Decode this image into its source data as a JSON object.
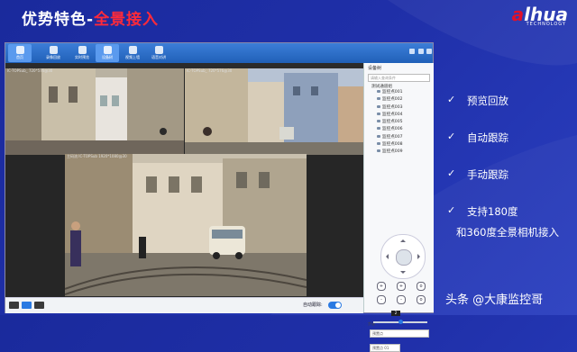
{
  "slide": {
    "title_main": "优势特色-",
    "title_accent": "全景接入",
    "brand_prefix": "a",
    "brand_rest": "lhua",
    "brand_sub": "TECHNOLOGY",
    "watermark": "头条 @大康监控哥"
  },
  "toolbar": {
    "items": [
      {
        "label": "首页",
        "active": true
      },
      {
        "label": "录像回放",
        "active": false
      },
      {
        "label": "实时预览",
        "active": false
      },
      {
        "label": "设备树",
        "active": true
      },
      {
        "label": "视频上墙",
        "active": false
      },
      {
        "label": "语音对讲",
        "active": false
      }
    ]
  },
  "videos": {
    "top_left_label": "IC-TOPSub_  720*576@30",
    "top_right_label": "IC-TOPSub_  720*576@30",
    "main_label": "主码流 IC-TOPSub 1920*1080@30"
  },
  "panel": {
    "header": "设备树",
    "search_placeholder": "请输入查询条件",
    "root": "测试通道组",
    "devices": [
      "监控点001",
      "监控点002",
      "监控点003",
      "监控点004",
      "监控点005",
      "监控点006",
      "监控点007",
      "监控点008",
      "监控点009"
    ],
    "speed_value": "2",
    "speed_label": "步速",
    "preset1": "预置点",
    "preset2": "预置点 01"
  },
  "bottom": {
    "auto_track_label": "自动跟踪:"
  },
  "features": [
    {
      "text": "预览回放"
    },
    {
      "text": "自动跟踪"
    },
    {
      "text": "手动跟踪"
    },
    {
      "text": "支持180度",
      "text2": "和360度全景相机接入"
    }
  ],
  "icons": {
    "check": "check-icon",
    "ptz": "ptz-joystick-icon"
  },
  "colors": {
    "background": "#1f2fa8",
    "accent": "#ff2a3a",
    "toolbar": "#2a6cc8"
  }
}
